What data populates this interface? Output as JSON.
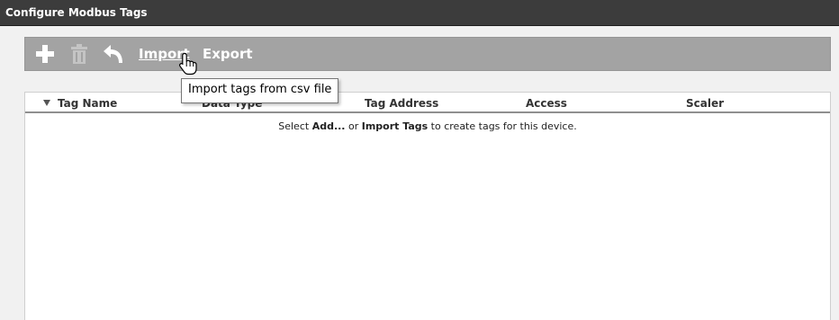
{
  "window": {
    "title": "Configure Modbus Tags"
  },
  "toolbar": {
    "add_icon": "plus-icon",
    "delete_icon": "trash-icon",
    "undo_icon": "undo-arrow-icon",
    "import_label": "Import",
    "export_label": "Export"
  },
  "tooltip": {
    "text": "Import tags from csv file"
  },
  "grid": {
    "columns": [
      "Tag Name",
      "Data Type",
      "Tag Address",
      "Access",
      "Scaler"
    ],
    "sort_icon": "sort-down-triangle-icon",
    "empty": {
      "pre": "Select ",
      "add": "Add...",
      "mid": " or ",
      "import": "Import Tags",
      "post": " to create tags for this device."
    }
  },
  "colors": {
    "titlebar": "#3c3c3c",
    "toolbar": "#a3a3a3",
    "panel": "#f1f1f1"
  }
}
